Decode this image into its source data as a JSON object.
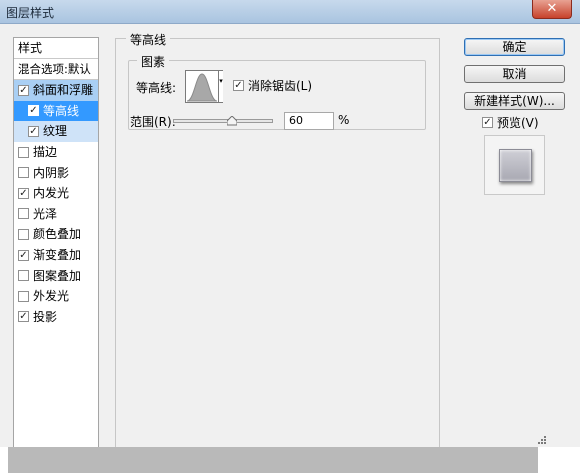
{
  "window": {
    "title": "图层样式",
    "close_glyph": "✕"
  },
  "sidebar": {
    "header": "样式",
    "blend_options": "混合选项:默认",
    "items": [
      {
        "label": "斜面和浮雕",
        "checked": true
      },
      {
        "label": "等高线",
        "checked": true
      },
      {
        "label": "纹理",
        "checked": true
      },
      {
        "label": "描边",
        "checked": false
      },
      {
        "label": "内阴影",
        "checked": false
      },
      {
        "label": "内发光",
        "checked": true
      },
      {
        "label": "光泽",
        "checked": false
      },
      {
        "label": "颜色叠加",
        "checked": false
      },
      {
        "label": "渐变叠加",
        "checked": true
      },
      {
        "label": "图案叠加",
        "checked": false
      },
      {
        "label": "外发光",
        "checked": false
      },
      {
        "label": "投影",
        "checked": true
      }
    ]
  },
  "contour_panel": {
    "group_title": "等高线",
    "subgroup_title": "图素",
    "contour_label": "等高线:",
    "antialias_label": "消除锯齿(L)",
    "antialias_checked": true,
    "range_label": "范围(R):",
    "range_value": "60",
    "range_unit": "%",
    "range_fraction": 0.6
  },
  "buttons": {
    "ok": "确定",
    "cancel": "取消",
    "new_style": "新建样式(W)...",
    "preview_label": "预览(V)",
    "preview_checked": true
  },
  "icons": {
    "checkmark": "✓",
    "dropdown": "▾",
    "close": "close-icon"
  }
}
